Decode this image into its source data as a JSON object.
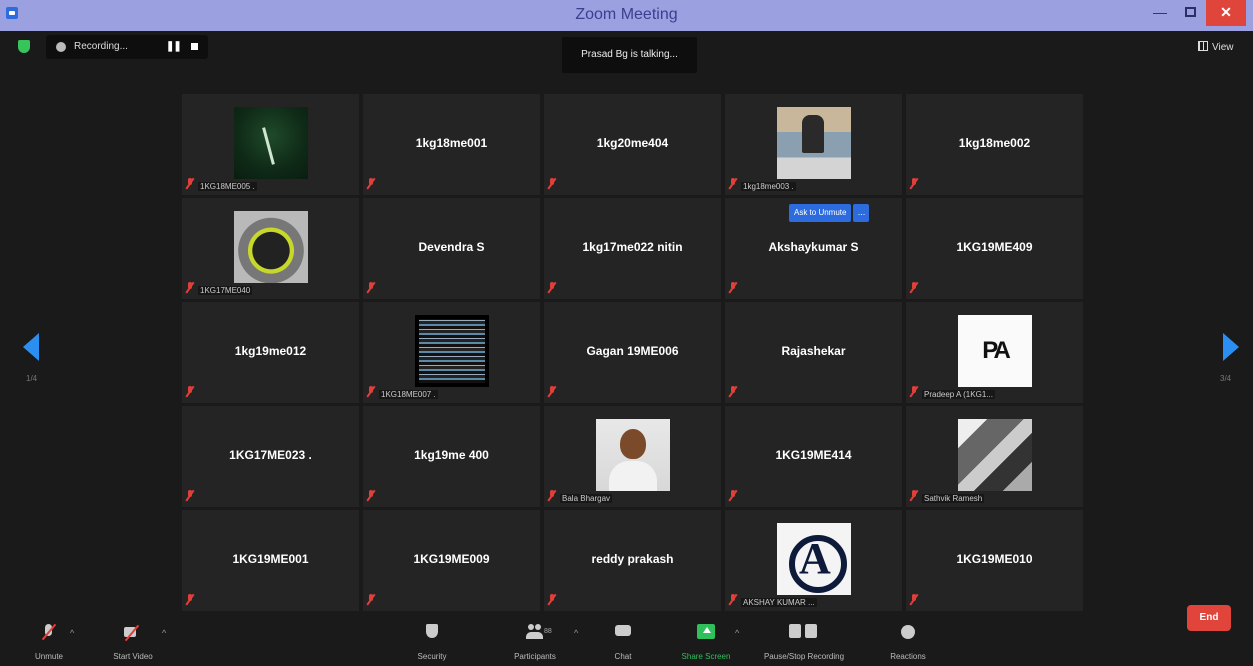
{
  "window": {
    "title": "Zoom Meeting"
  },
  "top": {
    "recording_label": "Recording...",
    "talking_text": "Prasad Bg is talking...",
    "view_label": "View"
  },
  "pages": {
    "left": "1/4",
    "right": "3/4"
  },
  "tiles": [
    {
      "name": "",
      "label": "1KG18ME005 ."
    },
    {
      "name": "1kg18me001",
      "label": ""
    },
    {
      "name": "1kg20me404",
      "label": ""
    },
    {
      "name": "",
      "label": "1kg18me003 ."
    },
    {
      "name": "1kg18me002",
      "label": ""
    },
    {
      "name": "",
      "label": "1KG17ME040"
    },
    {
      "name": "Devendra S",
      "label": ""
    },
    {
      "name": "1kg17me022 nitin",
      "label": ""
    },
    {
      "name": "Akshaykumar S",
      "label": ""
    },
    {
      "name": "1KG19ME409",
      "label": ""
    },
    {
      "name": "1kg19me012",
      "label": ""
    },
    {
      "name": "",
      "label": "1KG18ME007 ."
    },
    {
      "name": "Gagan 19ME006",
      "label": ""
    },
    {
      "name": "Rajashekar",
      "label": ""
    },
    {
      "name": "",
      "label": "Pradeep A (1KG1..."
    },
    {
      "name": "1KG17ME023 .",
      "label": ""
    },
    {
      "name": "1kg19me 400",
      "label": ""
    },
    {
      "name": "",
      "label": "Bala Bhargav"
    },
    {
      "name": "1KG19ME414",
      "label": ""
    },
    {
      "name": "",
      "label": "Sathvik Ramesh"
    },
    {
      "name": "1KG19ME001",
      "label": ""
    },
    {
      "name": "1KG19ME009",
      "label": ""
    },
    {
      "name": "reddy prakash",
      "label": ""
    },
    {
      "name": "",
      "label": "AKSHAY KUMAR ..."
    },
    {
      "name": "1KG19ME010",
      "label": ""
    }
  ],
  "avatar_logo_text": "PA",
  "ask_to_unmute": {
    "label": "Ask to Unmute",
    "more": "..."
  },
  "toolbar": {
    "unmute": "Unmute",
    "start_video": "Start Video",
    "security": "Security",
    "participants": "Participants",
    "participant_count": "88",
    "chat": "Chat",
    "share_screen": "Share Screen",
    "pause_stop_recording": "Pause/Stop Recording",
    "reactions": "Reactions",
    "end": "End"
  },
  "colors": {
    "accent": "#2d6cdf",
    "share_green": "#2fbf5b",
    "end_red": "#e0443a",
    "muted_red": "#e0403a"
  }
}
